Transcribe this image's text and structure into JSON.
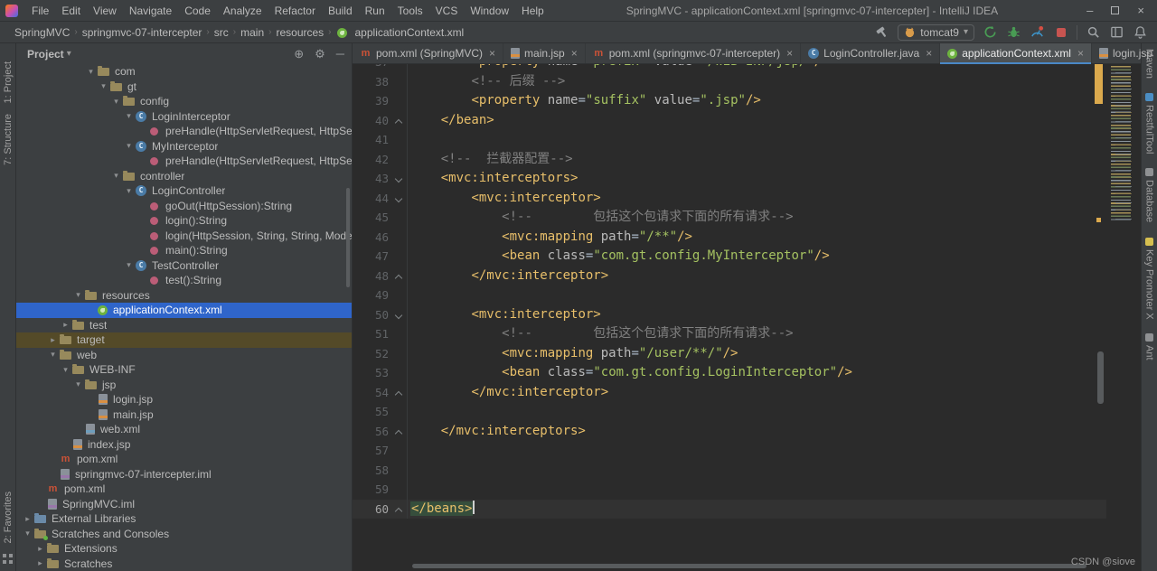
{
  "colors": {
    "panel_bg": "#3c3f41",
    "editor_bg": "#2b2b2b",
    "selection_blue": "#2f65ca",
    "tag_yellow": "#e8bf6a",
    "string_green": "#a5c261",
    "comment_gray": "#808080",
    "spring_green": "#6db33f",
    "maven_red": "#cb5237",
    "stripe_orange": "#dba94d",
    "stop_red": "#c75450"
  },
  "icons": {
    "chevron_down": "▾",
    "chevron_right": "▸",
    "gear": "⚙",
    "locate": "⊕",
    "hide": "─",
    "close": "×",
    "minimize": "–",
    "menu": "≡"
  },
  "titlebar": {
    "menus": [
      "File",
      "Edit",
      "View",
      "Navigate",
      "Code",
      "Analyze",
      "Refactor",
      "Build",
      "Run",
      "Tools",
      "VCS",
      "Window",
      "Help"
    ],
    "title": "SpringMVC - applicationContext.xml [springmvc-07-intercepter] - IntelliJ IDEA"
  },
  "navbar": {
    "breadcrumbs": [
      "SpringMVC",
      "springmvc-07-intercepter",
      "src",
      "main",
      "resources",
      "applicationContext.xml"
    ],
    "run_config_label": "tomcat9"
  },
  "left_stripe": {
    "top": [
      "1: Project",
      "7: Structure"
    ],
    "bottom": [
      "2: Favorites"
    ]
  },
  "right_stripe": {
    "items": [
      {
        "label": "Maven",
        "dot": ""
      },
      {
        "label": "RestfulTool",
        "dot": "#4b8ec4"
      },
      {
        "label": "Database",
        "dot": "#8f9193"
      },
      {
        "label": "Key Promoter X",
        "dot": "#d6bf50"
      },
      {
        "label": "Ant",
        "dot": "#8f9193"
      }
    ]
  },
  "project_panel": {
    "title": "Project",
    "tree": [
      {
        "label": "com",
        "depth": 5,
        "icon": "folder",
        "state": "open"
      },
      {
        "label": "gt",
        "depth": 6,
        "icon": "folder",
        "state": "open"
      },
      {
        "label": "config",
        "depth": 7,
        "icon": "folder",
        "state": "open"
      },
      {
        "label": "LoginInterceptor",
        "depth": 8,
        "icon": "class",
        "state": "open"
      },
      {
        "label": "preHandle(HttpServletRequest, HttpServle",
        "depth": 9,
        "icon": "method",
        "state": ""
      },
      {
        "label": "MyInterceptor",
        "depth": 8,
        "icon": "class",
        "state": "open"
      },
      {
        "label": "preHandle(HttpServletRequest, HttpServle",
        "depth": 9,
        "icon": "method",
        "state": ""
      },
      {
        "label": "controller",
        "depth": 7,
        "icon": "folder",
        "state": "open"
      },
      {
        "label": "LoginController",
        "depth": 8,
        "icon": "class",
        "state": "open"
      },
      {
        "label": "goOut(HttpSession):String",
        "depth": 9,
        "icon": "method",
        "state": ""
      },
      {
        "label": "login():String",
        "depth": 9,
        "icon": "method",
        "state": ""
      },
      {
        "label": "login(HttpSession, String, String, Model):S",
        "depth": 9,
        "icon": "method",
        "state": ""
      },
      {
        "label": "main():String",
        "depth": 9,
        "icon": "method",
        "state": ""
      },
      {
        "label": "TestController",
        "depth": 8,
        "icon": "class",
        "state": "open"
      },
      {
        "label": "test():String",
        "depth": 9,
        "icon": "method",
        "state": ""
      },
      {
        "label": "resources",
        "depth": 4,
        "icon": "folder",
        "state": "open"
      },
      {
        "label": "applicationContext.xml",
        "depth": 5,
        "icon": "spring",
        "state": "",
        "selected": true
      },
      {
        "label": "test",
        "depth": 3,
        "icon": "folder",
        "state": "closed"
      },
      {
        "label": "target",
        "depth": 2,
        "icon": "folder",
        "state": "closed",
        "highlight": true
      },
      {
        "label": "web",
        "depth": 2,
        "icon": "folder",
        "state": "open"
      },
      {
        "label": "WEB-INF",
        "depth": 3,
        "icon": "folder",
        "state": "open"
      },
      {
        "label": "jsp",
        "depth": 4,
        "icon": "folder",
        "state": "open"
      },
      {
        "label": "login.jsp",
        "depth": 5,
        "icon": "jsp",
        "state": ""
      },
      {
        "label": "main.jsp",
        "depth": 5,
        "icon": "jsp",
        "state": ""
      },
      {
        "label": "web.xml",
        "depth": 4,
        "icon": "xml",
        "state": ""
      },
      {
        "label": "index.jsp",
        "depth": 3,
        "icon": "jsp",
        "state": ""
      },
      {
        "label": "pom.xml",
        "depth": 2,
        "icon": "maven",
        "state": ""
      },
      {
        "label": "springmvc-07-intercepter.iml",
        "depth": 2,
        "icon": "iml",
        "state": ""
      },
      {
        "label": "pom.xml",
        "depth": 1,
        "icon": "maven",
        "state": ""
      },
      {
        "label": "SpringMVC.iml",
        "depth": 1,
        "icon": "iml",
        "state": ""
      },
      {
        "label": "External Libraries",
        "depth": 0,
        "icon": "lib",
        "state": "closed"
      },
      {
        "label": "Scratches and Consoles",
        "depth": 0,
        "icon": "scratch",
        "state": "open"
      },
      {
        "label": "Extensions",
        "depth": 1,
        "icon": "folder",
        "state": "closed"
      },
      {
        "label": "Scratches",
        "depth": 1,
        "icon": "folder",
        "state": "closed"
      }
    ]
  },
  "tab_bar": {
    "tabs": [
      {
        "label": "pom.xml (SpringMVC)",
        "icon": "maven",
        "active": false
      },
      {
        "label": "main.jsp",
        "icon": "jsp",
        "active": false
      },
      {
        "label": "pom.xml (springmvc-07-intercepter)",
        "icon": "maven",
        "active": false
      },
      {
        "label": "LoginController.java",
        "icon": "class",
        "active": false
      },
      {
        "label": "applicationContext.xml",
        "icon": "spring",
        "active": true
      },
      {
        "label": "login.jsp",
        "icon": "jsp",
        "active": false
      }
    ]
  },
  "editor": {
    "watermark": "CSDN @siove",
    "lines": [
      {
        "n": 37,
        "fold": "",
        "caret": false,
        "tokens": [
          [
            "p",
            "        "
          ],
          [
            "t",
            "<property"
          ],
          [
            "p",
            " "
          ],
          [
            "a",
            "name"
          ],
          [
            "p",
            "="
          ],
          [
            "s",
            "\"prefix\""
          ],
          [
            "p",
            " "
          ],
          [
            "a",
            "value"
          ],
          [
            "p",
            "="
          ],
          [
            "s",
            "\"/WEB-INF/jsp/\""
          ],
          [
            "t",
            "/>"
          ]
        ]
      },
      {
        "n": 38,
        "fold": "",
        "caret": false,
        "tokens": [
          [
            "p",
            "        "
          ],
          [
            "c",
            "<!-- 后缀 -->"
          ]
        ]
      },
      {
        "n": 39,
        "fold": "",
        "caret": false,
        "tokens": [
          [
            "p",
            "        "
          ],
          [
            "t",
            "<property"
          ],
          [
            "p",
            " "
          ],
          [
            "a",
            "name"
          ],
          [
            "p",
            "="
          ],
          [
            "s",
            "\"suffix\""
          ],
          [
            "p",
            " "
          ],
          [
            "a",
            "value"
          ],
          [
            "p",
            "="
          ],
          [
            "s",
            "\".jsp\""
          ],
          [
            "t",
            "/>"
          ]
        ]
      },
      {
        "n": 40,
        "fold": "end",
        "caret": false,
        "tokens": [
          [
            "p",
            "    "
          ],
          [
            "t",
            "</bean>"
          ]
        ]
      },
      {
        "n": 41,
        "fold": "",
        "caret": false,
        "tokens": []
      },
      {
        "n": 42,
        "fold": "",
        "caret": false,
        "tokens": [
          [
            "p",
            "    "
          ],
          [
            "c",
            "<!--  拦截器配置-->"
          ]
        ]
      },
      {
        "n": 43,
        "fold": "open",
        "caret": false,
        "tokens": [
          [
            "p",
            "    "
          ],
          [
            "t",
            "<mvc:interceptors>"
          ]
        ]
      },
      {
        "n": 44,
        "fold": "open",
        "caret": false,
        "tokens": [
          [
            "p",
            "        "
          ],
          [
            "t",
            "<mvc:interceptor>"
          ]
        ]
      },
      {
        "n": 45,
        "fold": "",
        "caret": false,
        "tokens": [
          [
            "p",
            "            "
          ],
          [
            "c",
            "<!--        包括这个包请求下面的所有请求-->"
          ]
        ]
      },
      {
        "n": 46,
        "fold": "",
        "caret": false,
        "tokens": [
          [
            "p",
            "            "
          ],
          [
            "t",
            "<mvc:mapping"
          ],
          [
            "p",
            " "
          ],
          [
            "a",
            "path"
          ],
          [
            "p",
            "="
          ],
          [
            "s",
            "\"/**\""
          ],
          [
            "t",
            "/>"
          ]
        ]
      },
      {
        "n": 47,
        "fold": "",
        "caret": false,
        "tokens": [
          [
            "p",
            "            "
          ],
          [
            "t",
            "<bean"
          ],
          [
            "p",
            " "
          ],
          [
            "a",
            "class"
          ],
          [
            "p",
            "="
          ],
          [
            "s",
            "\"com.gt.config.MyInterceptor\""
          ],
          [
            "t",
            "/>"
          ]
        ]
      },
      {
        "n": 48,
        "fold": "end",
        "caret": false,
        "tokens": [
          [
            "p",
            "        "
          ],
          [
            "t",
            "</mvc:interceptor>"
          ]
        ]
      },
      {
        "n": 49,
        "fold": "",
        "caret": false,
        "tokens": []
      },
      {
        "n": 50,
        "fold": "open",
        "caret": false,
        "tokens": [
          [
            "p",
            "        "
          ],
          [
            "t",
            "<mvc:interceptor>"
          ]
        ]
      },
      {
        "n": 51,
        "fold": "",
        "caret": false,
        "tokens": [
          [
            "p",
            "            "
          ],
          [
            "c",
            "<!--        包括这个包请求下面的所有请求-->"
          ]
        ]
      },
      {
        "n": 52,
        "fold": "",
        "caret": false,
        "tokens": [
          [
            "p",
            "            "
          ],
          [
            "t",
            "<mvc:mapping"
          ],
          [
            "p",
            " "
          ],
          [
            "a",
            "path"
          ],
          [
            "p",
            "="
          ],
          [
            "s",
            "\"/user/**/\""
          ],
          [
            "t",
            "/>"
          ]
        ]
      },
      {
        "n": 53,
        "fold": "",
        "caret": false,
        "tokens": [
          [
            "p",
            "            "
          ],
          [
            "t",
            "<bean"
          ],
          [
            "p",
            " "
          ],
          [
            "a",
            "class"
          ],
          [
            "p",
            "="
          ],
          [
            "s",
            "\"com.gt.config.LoginInterceptor\""
          ],
          [
            "t",
            "/>"
          ]
        ]
      },
      {
        "n": 54,
        "fold": "end",
        "caret": false,
        "tokens": [
          [
            "p",
            "        "
          ],
          [
            "t",
            "</mvc:interceptor>"
          ]
        ]
      },
      {
        "n": 55,
        "fold": "",
        "caret": false,
        "tokens": []
      },
      {
        "n": 56,
        "fold": "end",
        "caret": false,
        "tokens": [
          [
            "p",
            "    "
          ],
          [
            "t",
            "</mvc:interceptors>"
          ]
        ]
      },
      {
        "n": 57,
        "fold": "",
        "caret": false,
        "tokens": []
      },
      {
        "n": 58,
        "fold": "",
        "caret": false,
        "tokens": []
      },
      {
        "n": 59,
        "fold": "",
        "caret": false,
        "tokens": []
      },
      {
        "n": 60,
        "fold": "end",
        "caret": true,
        "tokens": [
          [
            "hl",
            "</beans>"
          ]
        ]
      }
    ]
  }
}
